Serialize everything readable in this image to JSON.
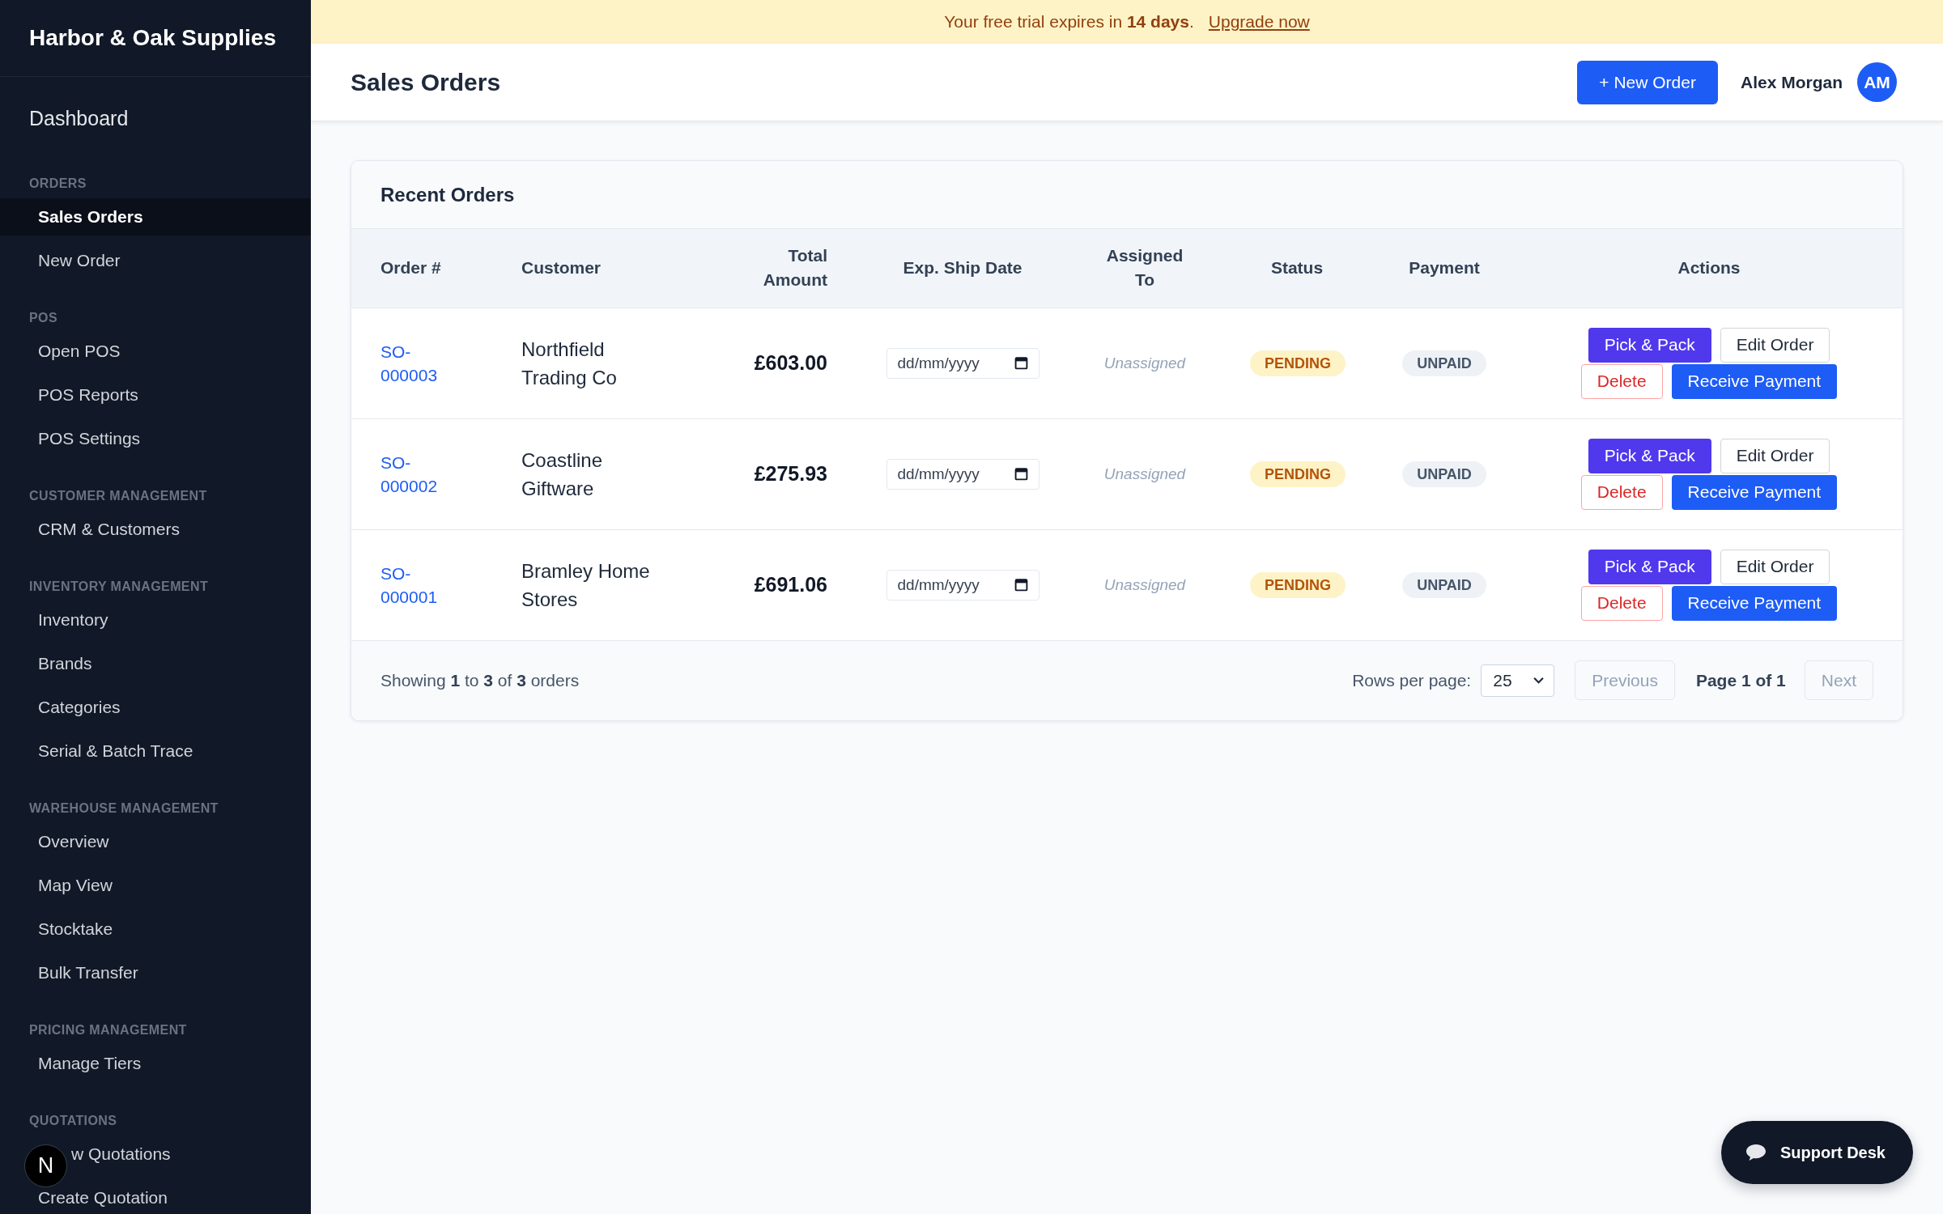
{
  "sidebar": {
    "brand": "Harbor & Oak Supplies",
    "dashboard": {
      "label": "Dashboard",
      "selected": false
    },
    "groups": [
      {
        "title": "ORDERS",
        "items": [
          {
            "label": "Sales Orders",
            "selected": true
          },
          {
            "label": "New Order",
            "selected": false
          }
        ]
      },
      {
        "title": "POS",
        "items": [
          {
            "label": "Open POS",
            "selected": false
          },
          {
            "label": "POS Reports",
            "selected": false
          },
          {
            "label": "POS Settings",
            "selected": false
          }
        ]
      },
      {
        "title": "CUSTOMER MANAGEMENT",
        "items": [
          {
            "label": "CRM & Customers",
            "selected": false
          }
        ]
      },
      {
        "title": "INVENTORY MANAGEMENT",
        "items": [
          {
            "label": "Inventory",
            "selected": false
          },
          {
            "label": "Brands",
            "selected": false
          },
          {
            "label": "Categories",
            "selected": false
          },
          {
            "label": "Serial & Batch Trace",
            "selected": false
          }
        ]
      },
      {
        "title": "WAREHOUSE MANAGEMENT",
        "items": [
          {
            "label": "Overview",
            "selected": false
          },
          {
            "label": "Map View",
            "selected": false
          },
          {
            "label": "Stocktake",
            "selected": false
          },
          {
            "label": "Bulk Transfer",
            "selected": false
          }
        ]
      },
      {
        "title": "PRICING MANAGEMENT",
        "items": [
          {
            "label": "Manage Tiers",
            "selected": false
          }
        ]
      },
      {
        "title": "QUOTATIONS",
        "items": [
          {
            "label": "w Quotations",
            "selected": false
          },
          {
            "label": "Create Quotation",
            "selected": false
          }
        ]
      }
    ]
  },
  "banner": {
    "text": "Your free trial expires in **14 days**.",
    "link": "Upgrade now"
  },
  "header": {
    "title": "Sales Orders",
    "new_button": "+ New Order",
    "user": {
      "name": "Alex Morgan",
      "initials": "AM"
    }
  },
  "orders_card": {
    "title": "Recent Orders",
    "columns": [
      "Order #",
      "Customer",
      "Total Amount",
      "Exp. Ship Date",
      "Assigned To",
      "Status",
      "Payment",
      "Actions"
    ],
    "rows": [
      {
        "order": "SO-000003",
        "customer": "Northfield Trading Co",
        "total": "£603.00",
        "ship_date": {
          "placeholder": "dd/mm/yyyy"
        },
        "assigned": "Unassigned",
        "status": "PENDING",
        "payment": "UNPAID",
        "actions": [
          {
            "label": "Pick & Pack",
            "kind": "pick"
          },
          {
            "label": "Edit Order",
            "kind": "edit"
          },
          {
            "label": "Delete",
            "kind": "delete"
          },
          {
            "label": "Receive Payment",
            "kind": "pay"
          }
        ]
      },
      {
        "order": "SO-000002",
        "customer": "Coastline Giftware",
        "total": "£275.93",
        "ship_date": {
          "placeholder": "dd/mm/yyyy"
        },
        "assigned": "Unassigned",
        "status": "PENDING",
        "payment": "UNPAID",
        "actions": [
          {
            "label": "Pick & Pack",
            "kind": "pick"
          },
          {
            "label": "Edit Order",
            "kind": "edit"
          },
          {
            "label": "Delete",
            "kind": "delete"
          },
          {
            "label": "Receive Payment",
            "kind": "pay"
          }
        ]
      },
      {
        "order": "SO-000001",
        "customer": "Bramley Home Stores",
        "total": "£691.06",
        "ship_date": {
          "placeholder": "dd/mm/yyyy"
        },
        "assigned": "Unassigned",
        "status": "PENDING",
        "payment": "UNPAID",
        "actions": [
          {
            "label": "Pick & Pack",
            "kind": "pick"
          },
          {
            "label": "Edit Order",
            "kind": "edit"
          },
          {
            "label": "Delete",
            "kind": "delete"
          },
          {
            "label": "Receive Payment",
            "kind": "pay"
          }
        ]
      }
    ],
    "footer": {
      "summary": "Showing **1** to **3** of **3** orders",
      "rows_per_page_label": "Rows per page:",
      "rows_per_page": "25",
      "previous": {
        "label": "Previous",
        "disabled": true
      },
      "page_info": "Page 1 of 1",
      "next": {
        "label": "Next",
        "disabled": true
      }
    }
  },
  "support_button": {
    "label": "Support Desk"
  },
  "dev_badge": {
    "label": "N"
  }
}
